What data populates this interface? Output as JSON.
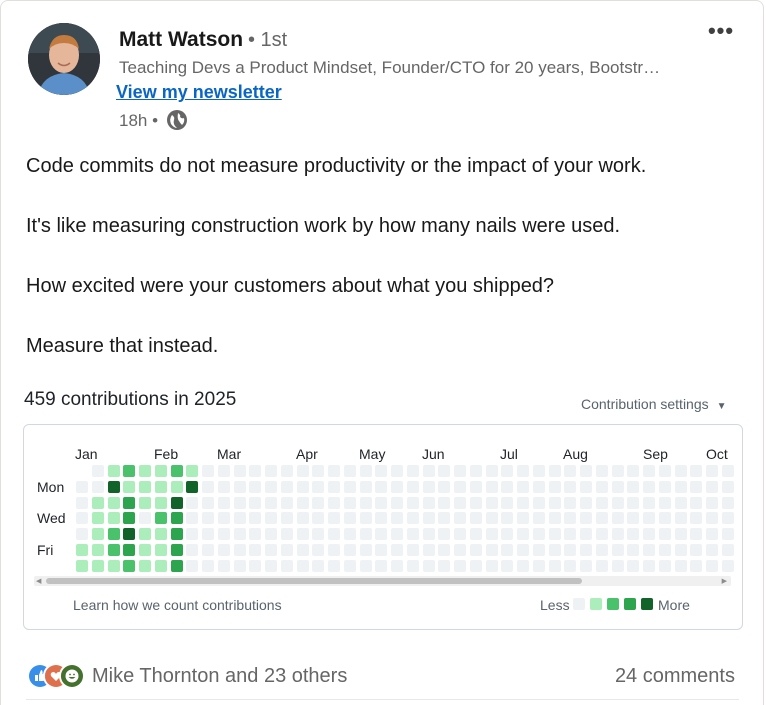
{
  "author": {
    "name": "Matt Watson",
    "degree": "• 1st",
    "headline": "Teaching Devs a Product Mindset, Founder/CTO for 20 years, Bootstr…",
    "newsletter_link": "View my newsletter",
    "time": "18h •"
  },
  "menu": {
    "more_label": "•••"
  },
  "post": {
    "paragraphs": [
      "Code commits do not measure productivity or the impact of your work.",
      "It's like measuring construction work by how many nails were used.",
      "How excited were your customers about what you shipped?",
      "Measure that instead."
    ]
  },
  "contributions": {
    "title": "459 contributions in 2025",
    "settings_label": "Contribution settings",
    "months": [
      "Jan",
      "Feb",
      "Mar",
      "Apr",
      "May",
      "Jun",
      "Jul",
      "Aug",
      "Sep",
      "Oct"
    ],
    "days": [
      "Mon",
      "Wed",
      "Fri"
    ],
    "learn_link": "Learn how we count contributions",
    "legend_less": "Less",
    "legend_more": "More",
    "colors": [
      "#eff2f5",
      "#aceebb",
      "#4ac26b",
      "#2da44e",
      "#116329"
    ],
    "active_weeks": [
      [
        null,
        0,
        0,
        0,
        0,
        1,
        1
      ],
      [
        0,
        0,
        1,
        1,
        1,
        1,
        1
      ],
      [
        1,
        4,
        1,
        1,
        2,
        2,
        1
      ],
      [
        2,
        1,
        3,
        3,
        4,
        3,
        2
      ],
      [
        1,
        1,
        1,
        0,
        1,
        1,
        1
      ],
      [
        1,
        1,
        1,
        2,
        1,
        1,
        1
      ],
      [
        2,
        1,
        4,
        3,
        3,
        3,
        3
      ],
      [
        1,
        4,
        null,
        null,
        null,
        null,
        null
      ]
    ]
  },
  "social": {
    "reactors": "Mike Thornton and 23 others",
    "comments": "24 comments",
    "reaction_colors": [
      "#378fe9",
      "#df704d",
      "#44712e"
    ]
  }
}
